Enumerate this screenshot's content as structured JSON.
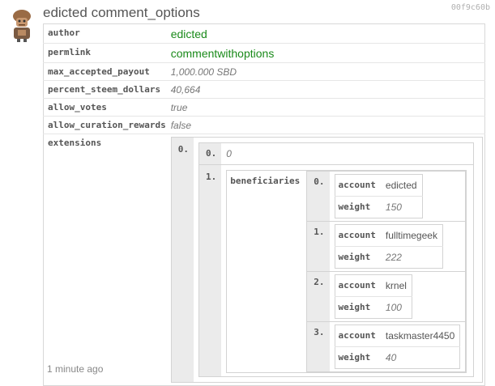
{
  "operation": {
    "user": "edicted",
    "type": "comment_options",
    "hash": "00f9c60b"
  },
  "params": {
    "author": {
      "key": "author",
      "value": "edicted"
    },
    "permlink": {
      "key": "permlink",
      "value": "commentwithoptions"
    },
    "max_accepted_payout": {
      "key": "max_accepted_payout",
      "value": "1,000.000 SBD"
    },
    "percent_steem_dollars": {
      "key": "percent_steem_dollars",
      "value": "40,664"
    },
    "allow_votes": {
      "key": "allow_votes",
      "value": "true"
    },
    "allow_curation_rewards": {
      "key": "allow_curation_rewards",
      "value": "false"
    },
    "extensions": {
      "key": "extensions"
    }
  },
  "extensions": {
    "outer_index": "0.",
    "items": [
      {
        "index": "0.",
        "value": "0"
      },
      {
        "index": "1.",
        "key": "beneficiaries"
      }
    ],
    "beneficiaries": [
      {
        "index": "0.",
        "account_key": "account",
        "account": "edicted",
        "weight_key": "weight",
        "weight": "150"
      },
      {
        "index": "1.",
        "account_key": "account",
        "account": "fulltimegeek",
        "weight_key": "weight",
        "weight": "222"
      },
      {
        "index": "2.",
        "account_key": "account",
        "account": "krnel",
        "weight_key": "weight",
        "weight": "100"
      },
      {
        "index": "3.",
        "account_key": "account",
        "account": "taskmaster4450",
        "weight_key": "weight",
        "weight": "40"
      }
    ]
  },
  "timestamp": "1 minute ago",
  "avatar_icon": "robot-avatar-icon"
}
